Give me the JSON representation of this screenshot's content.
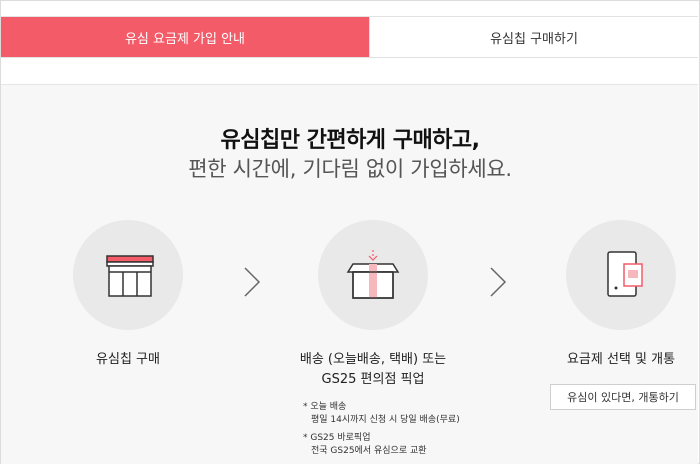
{
  "tabs": [
    {
      "label": "유심 요금제 가입 안내",
      "active": true
    },
    {
      "label": "유심칩 구매하기",
      "active": false
    }
  ],
  "headline": {
    "line1": "유심칩만 간편하게 구매하고,",
    "line2": "편한 시간에, 기다림 없이 가입하세요."
  },
  "steps": [
    {
      "icon": "store-icon",
      "label": "유심칩 구매"
    },
    {
      "icon": "package-box-icon",
      "label_line1": "배송 (오늘배송, 택배) 또는",
      "label_line2": "GS25 편의점 픽업"
    },
    {
      "icon": "sim-phone-icon",
      "label": "요금제 선택 및 개통"
    }
  ],
  "activate_button": "유심이 있다면, 개통하기",
  "notes": [
    {
      "title": "* 오늘 배송",
      "detail": "평일 14시까지 신청 시 당일 배송(무료)"
    },
    {
      "title": "* GS25 바로픽업",
      "detail": "전국 GS25에서 유심으로 교환"
    }
  ],
  "colors": {
    "accent": "#f45b69",
    "band": "#f7f7f7",
    "circle": "#e9e9e9"
  }
}
